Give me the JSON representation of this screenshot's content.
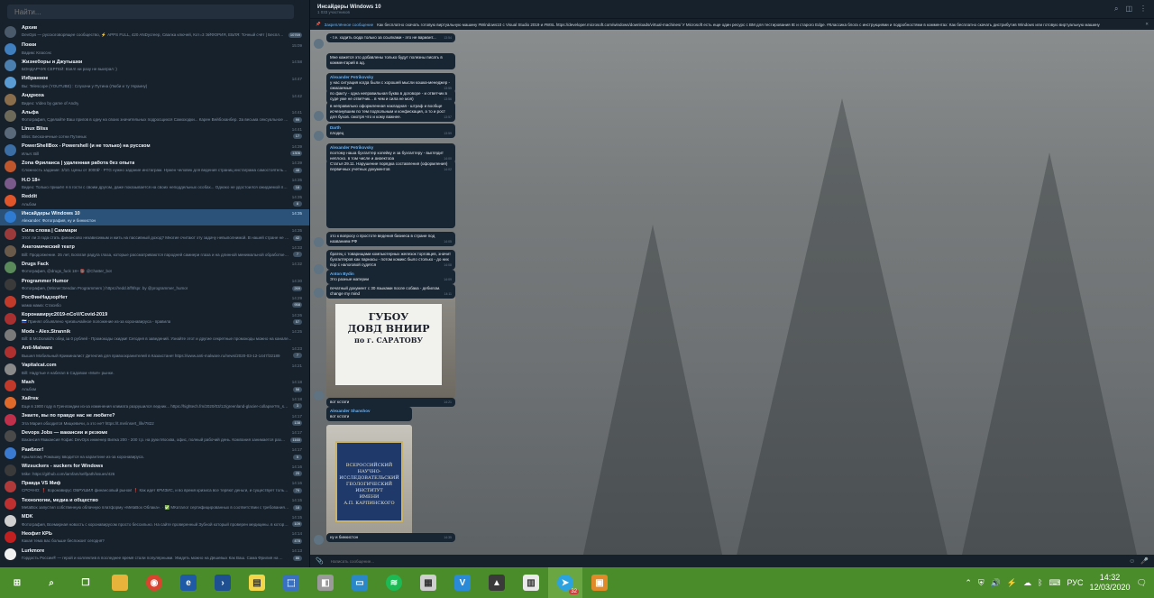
{
  "search": {
    "placeholder": "Найти..."
  },
  "chats": [
    {
      "title": "Архив",
      "preview": "DevOps — русскоговорящее сообщество, ⚡ APPS FULL, 420 ANDycreep, Свалка ключей, Кот=3 ЭЙФОРИЯ, ЕБЛЯ: Точный счёт | Бесплатный ст...",
      "time": "",
      "badge": "10769",
      "color": "#4a5a6a"
    },
    {
      "title": "Покки",
      "preview": "Вадим: Классно",
      "time": "15:09",
      "badge": "",
      "color": "#3f7fbf"
    },
    {
      "title": "Жизнеборы и Джугышки",
      "preview": "БОНДАРЧУК СЕРГЕЙ: Взял! ни разу не выиграл :)",
      "time": "14:58",
      "badge": "",
      "color": "#4b7fb0"
    },
    {
      "title": "Избранное",
      "preview": "Вы: Telescope (YOUTUBE) : Слухачи у Путина (Люби и ту Украину)",
      "time": "14:47",
      "badge": "",
      "color": "#5a9bd4"
    },
    {
      "title": "Андрюха",
      "preview": "Видео: Video by game of Andry",
      "time": "14:42",
      "badge": "",
      "color": "#8a6d4a"
    },
    {
      "title": "Альфа",
      "preview": "Фотография, Сделайте Ваш пригов в одну на своих значительных подросщихся Самоходки... Карен Вейбоханбер. За весьма сексуальное насилие на...",
      "time": "14:41",
      "badge": "99",
      "color": "#6d6a5a"
    },
    {
      "title": "Linux Bliss",
      "preview": "Bliss: Бесконечные сотни Путиных",
      "time": "14:41",
      "badge": "17",
      "color": "#5a6a7a"
    },
    {
      "title": "PowerShellBox - Powershell (и не только) на русском",
      "preview": "Илья: Bill",
      "time": "14:39",
      "badge": "1306",
      "color": "#3a6ea5"
    },
    {
      "title": "Zona Фрилансa | удаленная работа без опыта",
      "preview": "Сложность задание: 3/10. Цены от 3000₽ · PTG нужно задание инстаграм. Нужен человек для ведения страниц инстаграма самостоятельно заполн...",
      "time": "14:39",
      "badge": "48",
      "color": "#c0562c"
    },
    {
      "title": "H.O 18+",
      "preview": "Видео: Только пришёл я в гости с своим другом, даже показывается на своих неподдельных особах... Однако не удостоился ожидаемой подобн...",
      "time": "14:35",
      "badge": "18",
      "color": "#7a5a8a"
    },
    {
      "title": "Reddit",
      "preview": "Альбом",
      "time": "14:35",
      "badge": "8",
      "color": "#e0552a"
    },
    {
      "title": "Инсайдеры Windows 10",
      "preview": "Alexander: Фотография, ну и бинкистон",
      "time": "14:35",
      "badge": "",
      "color": "#2e7bd1",
      "active": true
    },
    {
      "title": "Сила слова | Саммари",
      "preview": "Этот ли 3 года стать финансово независимым и жить на пассивный доход? Многие считают эту задачу невыполнимой. В нашей стране не принято...",
      "time": "14:35",
      "badge": "42",
      "color": "#9a3a3a"
    },
    {
      "title": "Анатомический театр",
      "preview": "Bill: Продолжение. 35 лет, Богатая радуга глаза, которые рассматриваются пародней самиери глаза и на длинной минимальной обработке в...",
      "time": "14:33",
      "badge": "7",
      "color": "#6a5a4a"
    },
    {
      "title": "Drugs Fack",
      "preview": "Фотография, @drugs_fuck 18+ 🔞 @Chatter_bot",
      "time": "14:32",
      "badge": "",
      "color": "#5a8a5a"
    },
    {
      "title": "Programmer Humor",
      "preview": "Фотография, (Winner:Sendan Programmers ) https://redd.it/fhfspr. by @programmer_humor",
      "time": "14:30",
      "badge": "269",
      "color": "#3a3a3a"
    },
    {
      "title": "РосФинНадзорНет",
      "preview": "мама мама: Стасибо",
      "time": "14:29",
      "badge": "958",
      "color": "#c23a2a"
    },
    {
      "title": "Коронавирус2019-nCoV/Covid-2019",
      "preview": "🇷🇺 Принял объявлено чрезвычайное положение из-за коронавируса - правила",
      "time": "14:26",
      "badge": "57",
      "color": "#a83030"
    },
    {
      "title": "Mods - Alex.Strannik",
      "preview": "Bill: В McDonald's обед за 0 рублей - Промокоды скидки! Сегодня в заведений. Узнайте этот и другие секретные промокоды можно на канале...",
      "time": "14:25",
      "badge": "",
      "color": "#7a7a7a"
    },
    {
      "title": "Anti-Malware",
      "preview": "Вышел Мобильный Криминалист Детектив для правоохранителей в Казахстане! https://www.anti-malware.ru/news/2020-03-12-1447/32189",
      "time": "14:23",
      "badge": "7",
      "color": "#b03030"
    },
    {
      "title": "Vapitalcat.com",
      "preview": "Bill: Надутые я набегал в Садовом «Моё» рынке.",
      "time": "14:21",
      "badge": "",
      "color": "#8a8a8a"
    },
    {
      "title": "Mash",
      "preview": "Альбом",
      "time": "14:18",
      "badge": "58",
      "color": "#c0392b"
    },
    {
      "title": "Хайтек",
      "preview": "Еще в 1900 году в Гренландии из-за изменения климата разрушился ледник... https://hightech.fm/2020/03/12/greenland-glacier-collapse?m_source=tg",
      "time": "14:18",
      "badge": "3",
      "color": "#e06a2a"
    },
    {
      "title": "Знаете, вы по правде нас не любите?",
      "preview": "Эта Мария обходится Мицкевичи, а это не? https://t.me/insert_life/7822",
      "time": "14:17",
      "badge": "138",
      "color": "#c0304a"
    },
    {
      "title": "Devops Jobs — вакансии и резюме",
      "preview": "Вакансия #вакансия #офис DevOps инженер Вилка 200 - 200 т.р. на руки Москва, офис, полный рабочий день. Компания занимается разработкой...",
      "time": "14:17",
      "badge": "1160",
      "color": "#4a4a4a"
    },
    {
      "title": "Раиблог!",
      "preview": "Крылатому Ромашку вводится на карантине из-за коронавируса.",
      "time": "14:17",
      "badge": "5",
      "color": "#3a7ad0"
    },
    {
      "title": "Wizsuckers - suckers for Windows",
      "preview": "Mike: https://github.com/iamfam/selfpath/issues/426",
      "time": "14:16",
      "badge": "25",
      "color": "#3a3a3a"
    },
    {
      "title": "Правда VS Миф",
      "preview": "СРОЧНО: ❗ Коронавирус ОБРУШИЛ финансовый рынок! ❗ Как идет КРИЗИС, и во время кризиса все теряют деньги, и существует только 3 способ...",
      "time": "14:16",
      "badge": "79",
      "color": "#b03a3a"
    },
    {
      "title": "Технологии, медиа и общество",
      "preview": "MetaBox запустил собственную облачную платформу «MetaBox Облака». · ✅ МКаталог сертифицированных в соответствии с требованиями государ...",
      "time": "14:15",
      "badge": "18",
      "color": "#c03030"
    },
    {
      "title": "MDK",
      "preview": "Фотография, Всемирная новость с коронавирусом просто бессильно. На сайте проверенный Зубной который проверен медицины. в котором все хорошо, что...",
      "time": "14:15",
      "badge": "109",
      "color": "#d0d0d0"
    },
    {
      "title": "Неофит КРЬ",
      "preview": "Какая тема вас больше беспокоит сегодня?",
      "time": "14:14",
      "badge": "478",
      "color": "#c02020"
    },
    {
      "title": "Lurkmore",
      "preview": "Гордость России® — герой и коллектив в последнее время стали популярными. Увидеть можно на Дешевых Как Ваш. Сама Фрилия на ...",
      "time": "14:13",
      "badge": "86",
      "color": "#f0f0f0"
    }
  ],
  "header": {
    "title": "Инсайдеры Windows 10",
    "subtitle": "1 033 участников"
  },
  "pinned": {
    "label": "Закреплённое сообщение",
    "text": "Как бесплатно скачать готовую виртуальную машину #Windows10 с Visual Studio 2019 и #WSL https://developer.microsoft.com/windows/downloads/virtual-machines/ У Microsoft есть еще один ресурс с ВМ для тестирования IE и старого Edge. #Классика блога с инструкциями и подробностями в комментах: Как бесплатно скачать дистрибутив Windows или готовую виртуальную машину"
  },
  "messages": [
    {
      "from": "",
      "text": "- т.е. ходить сюда только за ссылками - это не вариант...",
      "time": "13:54"
    },
    {
      "from": "",
      "text": "Мне кажется это добавлены только будут полезны писать в комментарий в ад.",
      "time": ""
    },
    {
      "from": "Alexander Petrikovsky",
      "text": "у нас ситуация когда были с хорошей мысли кошка-менеджер - ожидаемые",
      "time": "13:55"
    },
    {
      "from": "",
      "text": "по факту - одна неправильная буква в договоре - и ответчик в суде уже не ответчик... в чем и сила не моя)",
      "time": "13:56"
    },
    {
      "from": "",
      "text": "в неправильно оформленная накладная - штраф и вообще исчезнувшим по тем подпольным и конфискация, а то и рост для бухов. смотря что и кому важнее.",
      "time": "13:57"
    },
    {
      "from": "Darth",
      "text": "плодец",
      "time": "13:59"
    },
    {
      "from": "Alexander Petrikovsky",
      "text": "поэтому наша бухгалтер копейку и за бухгалтеру - выглядит неплохо, в том числе и директора",
      "time": "14:00"
    },
    {
      "from": "",
      "text": "Статья 29.11. Нарушение порядка составления (оформления) первичных учетных документов",
      "time": "14:02"
    },
    {
      "from": "",
      "text": "это к вопросу о простоте ведения бизнеса в стране под названием РФ",
      "time": "14:05"
    },
    {
      "from": "",
      "text": "братец с товарищами компьютерных железок торговцев, значит бухгалтеров как парнасы - потом комикс было столько - до них пор с налоговой судятся",
      "time": "14:08"
    },
    {
      "from": "Anton Bydin",
      "text": "Это разные материи",
      "time": "14:09"
    },
    {
      "from": "",
      "text": "печатный документ с 30 языками после собака - дебилом. change my mind",
      "time": "14:11"
    },
    {
      "from": "Darth",
      "text": "вот кстати",
      "time": "14:21"
    },
    {
      "from": "Alexander Shanshov",
      "text": "вот кстати",
      "time": ""
    },
    {
      "from": "",
      "text": "ну и бинкистон",
      "time": "14:35"
    }
  ],
  "photo1_sign": {
    "line1": "ГУБОУ",
    "line2": "ДОВД ВНИИР",
    "line3": "по г. САРАТОВУ"
  },
  "photo2_sign": {
    "line1": "ВСЕРОССИЙСКИЙ",
    "line2": "НАУЧНО-",
    "line3": "ИССЛЕДОВАТЕЛЬСКИЙ",
    "line4": "ГЕОЛОГИЧЕСКИЙ",
    "line5": "ИНСТИТУТ",
    "line6": "ИМЕНИ",
    "line7": "А.П. КАРПИНСКОГО"
  },
  "composer": {
    "placeholder": "Написать сообщение..."
  },
  "taskbar": {
    "lang": "РУС",
    "time": "14:32",
    "date": "12/03/2020",
    "telegram_badge": "32"
  },
  "colors": {
    "sidebar_bg": "#17212b",
    "active_chat": "#2b5278",
    "taskbar": "#4a8c2a",
    "accent": "#6ab2f2"
  }
}
